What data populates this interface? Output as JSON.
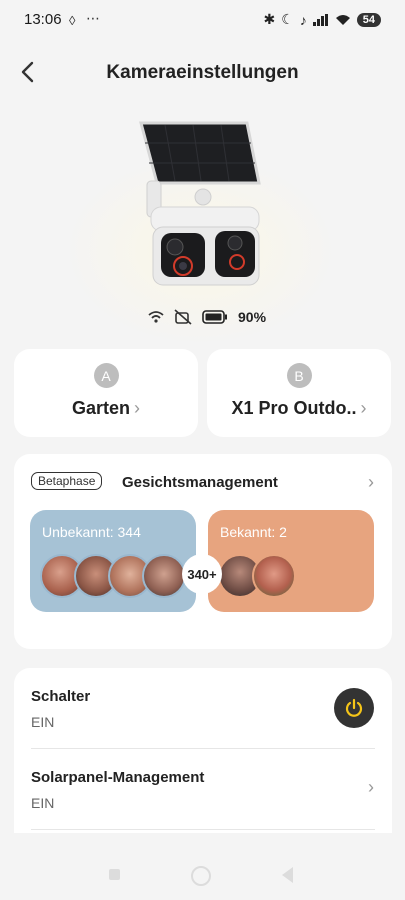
{
  "status": {
    "time": "13:06",
    "battery": "54"
  },
  "header": {
    "title": "Kameraeinstellungen"
  },
  "device": {
    "battery_percent": "90%"
  },
  "locations": [
    {
      "badge": "A",
      "name": "Garten"
    },
    {
      "badge": "B",
      "name": "X1 Pro Outdo.."
    }
  ],
  "faces": {
    "beta_label": "Betaphase",
    "title": "Gesichtsmanagement",
    "unknown_label": "Unbekannt: 344",
    "unknown_more": "340+",
    "known_label": "Bekannt: 2"
  },
  "settings": [
    {
      "title": "Schalter",
      "value": "EIN"
    },
    {
      "title": "Solarpanel-Management",
      "value": "EIN"
    }
  ],
  "colors": {
    "unknown_panel": "#a6c2d5",
    "known_panel": "#e7a47f",
    "power_icon": "#f5c518"
  }
}
